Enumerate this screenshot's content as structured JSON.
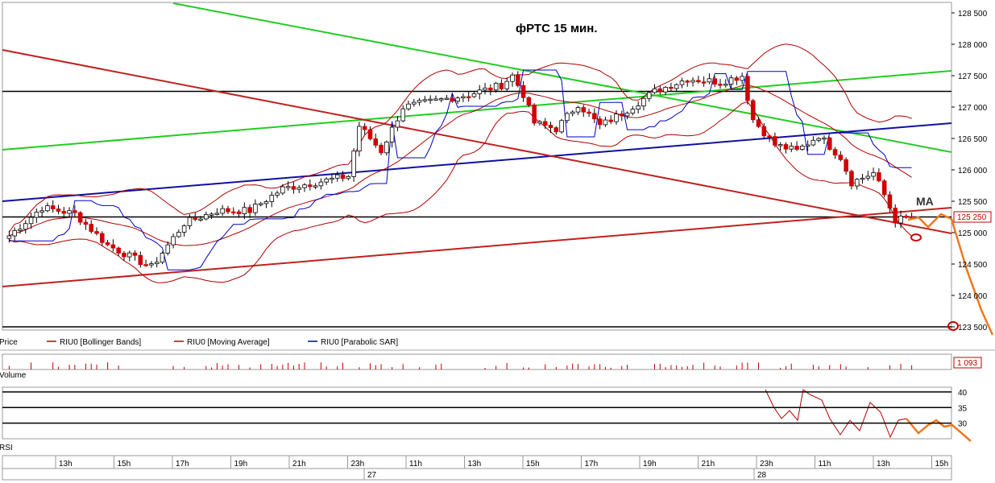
{
  "chart_data": [
    {
      "type": "candlestick",
      "title": "фРТС   15 мин.",
      "annotation": "MA",
      "price_label": "125 250",
      "y_ticks": [
        "128 500",
        "128 000",
        "127 500",
        "127 000",
        "126 500",
        "126 000",
        "125 500",
        "125 000",
        "124 500",
        "124 000",
        "123 500"
      ],
      "y_tick_values": [
        128500,
        128000,
        127500,
        127000,
        126500,
        126000,
        125500,
        125000,
        124500,
        124000,
        123500
      ],
      "ylim": [
        123400,
        128650
      ],
      "legend": [
        {
          "label": "Price",
          "color": "#d00000"
        },
        {
          "label": "RIU0 [Bollinger Bands]",
          "color": "#c00000"
        },
        {
          "label": "RIU0 [Moving Average]",
          "color": "#c00000"
        },
        {
          "label": "RIU0 [Parabolic SAR]",
          "color": "#0000c0"
        }
      ],
      "levels": [
        127250,
        125250,
        123500
      ],
      "close_anchors": [
        {
          "bar": 0,
          "close": 124950
        },
        {
          "bar": 6,
          "close": 125400
        },
        {
          "bar": 12,
          "close": 125300
        },
        {
          "bar": 18,
          "close": 124800
        },
        {
          "bar": 26,
          "close": 124450
        },
        {
          "bar": 32,
          "close": 125150
        },
        {
          "bar": 38,
          "close": 125350
        },
        {
          "bar": 44,
          "close": 125350
        },
        {
          "bar": 50,
          "close": 125700
        },
        {
          "bar": 56,
          "close": 125800
        },
        {
          "bar": 62,
          "close": 125900
        },
        {
          "bar": 64,
          "close": 126700
        },
        {
          "bar": 68,
          "close": 126300
        },
        {
          "bar": 72,
          "close": 127000
        },
        {
          "bar": 78,
          "close": 127100
        },
        {
          "bar": 84,
          "close": 127200
        },
        {
          "bar": 90,
          "close": 127350
        },
        {
          "bar": 92,
          "close": 127500
        },
        {
          "bar": 94,
          "close": 127200
        },
        {
          "bar": 96,
          "close": 126750
        },
        {
          "bar": 100,
          "close": 126650
        },
        {
          "bar": 104,
          "close": 127050
        },
        {
          "bar": 108,
          "close": 126700
        },
        {
          "bar": 112,
          "close": 126900
        },
        {
          "bar": 118,
          "close": 127250
        },
        {
          "bar": 124,
          "close": 127450
        },
        {
          "bar": 130,
          "close": 127400
        },
        {
          "bar": 134,
          "close": 127500
        },
        {
          "bar": 136,
          "close": 126800
        },
        {
          "bar": 140,
          "close": 126400
        },
        {
          "bar": 144,
          "close": 126300
        },
        {
          "bar": 148,
          "close": 126550
        },
        {
          "bar": 152,
          "close": 126200
        },
        {
          "bar": 154,
          "close": 125800
        },
        {
          "bar": 158,
          "close": 125950
        },
        {
          "bar": 160,
          "close": 125600
        },
        {
          "bar": 162,
          "close": 125200
        },
        {
          "bar": 165,
          "close": 125250
        }
      ]
    },
    {
      "type": "bar",
      "name": "Volume",
      "value_label": "1 093"
    },
    {
      "type": "line",
      "name": "RSI",
      "y_ticks": [
        "40",
        "35",
        "30"
      ],
      "y_tick_values": [
        40,
        35,
        30
      ],
      "levels": [
        40,
        35,
        30
      ]
    }
  ],
  "x_axis": {
    "time_labels": [
      "13h",
      "15h",
      "17h",
      "19h",
      "21h",
      "23h",
      "11h",
      "13h",
      "15h",
      "17h",
      "19h",
      "21h",
      "23h",
      "11h",
      "13h",
      "15h"
    ],
    "day_labels": [
      "27",
      "28"
    ]
  }
}
